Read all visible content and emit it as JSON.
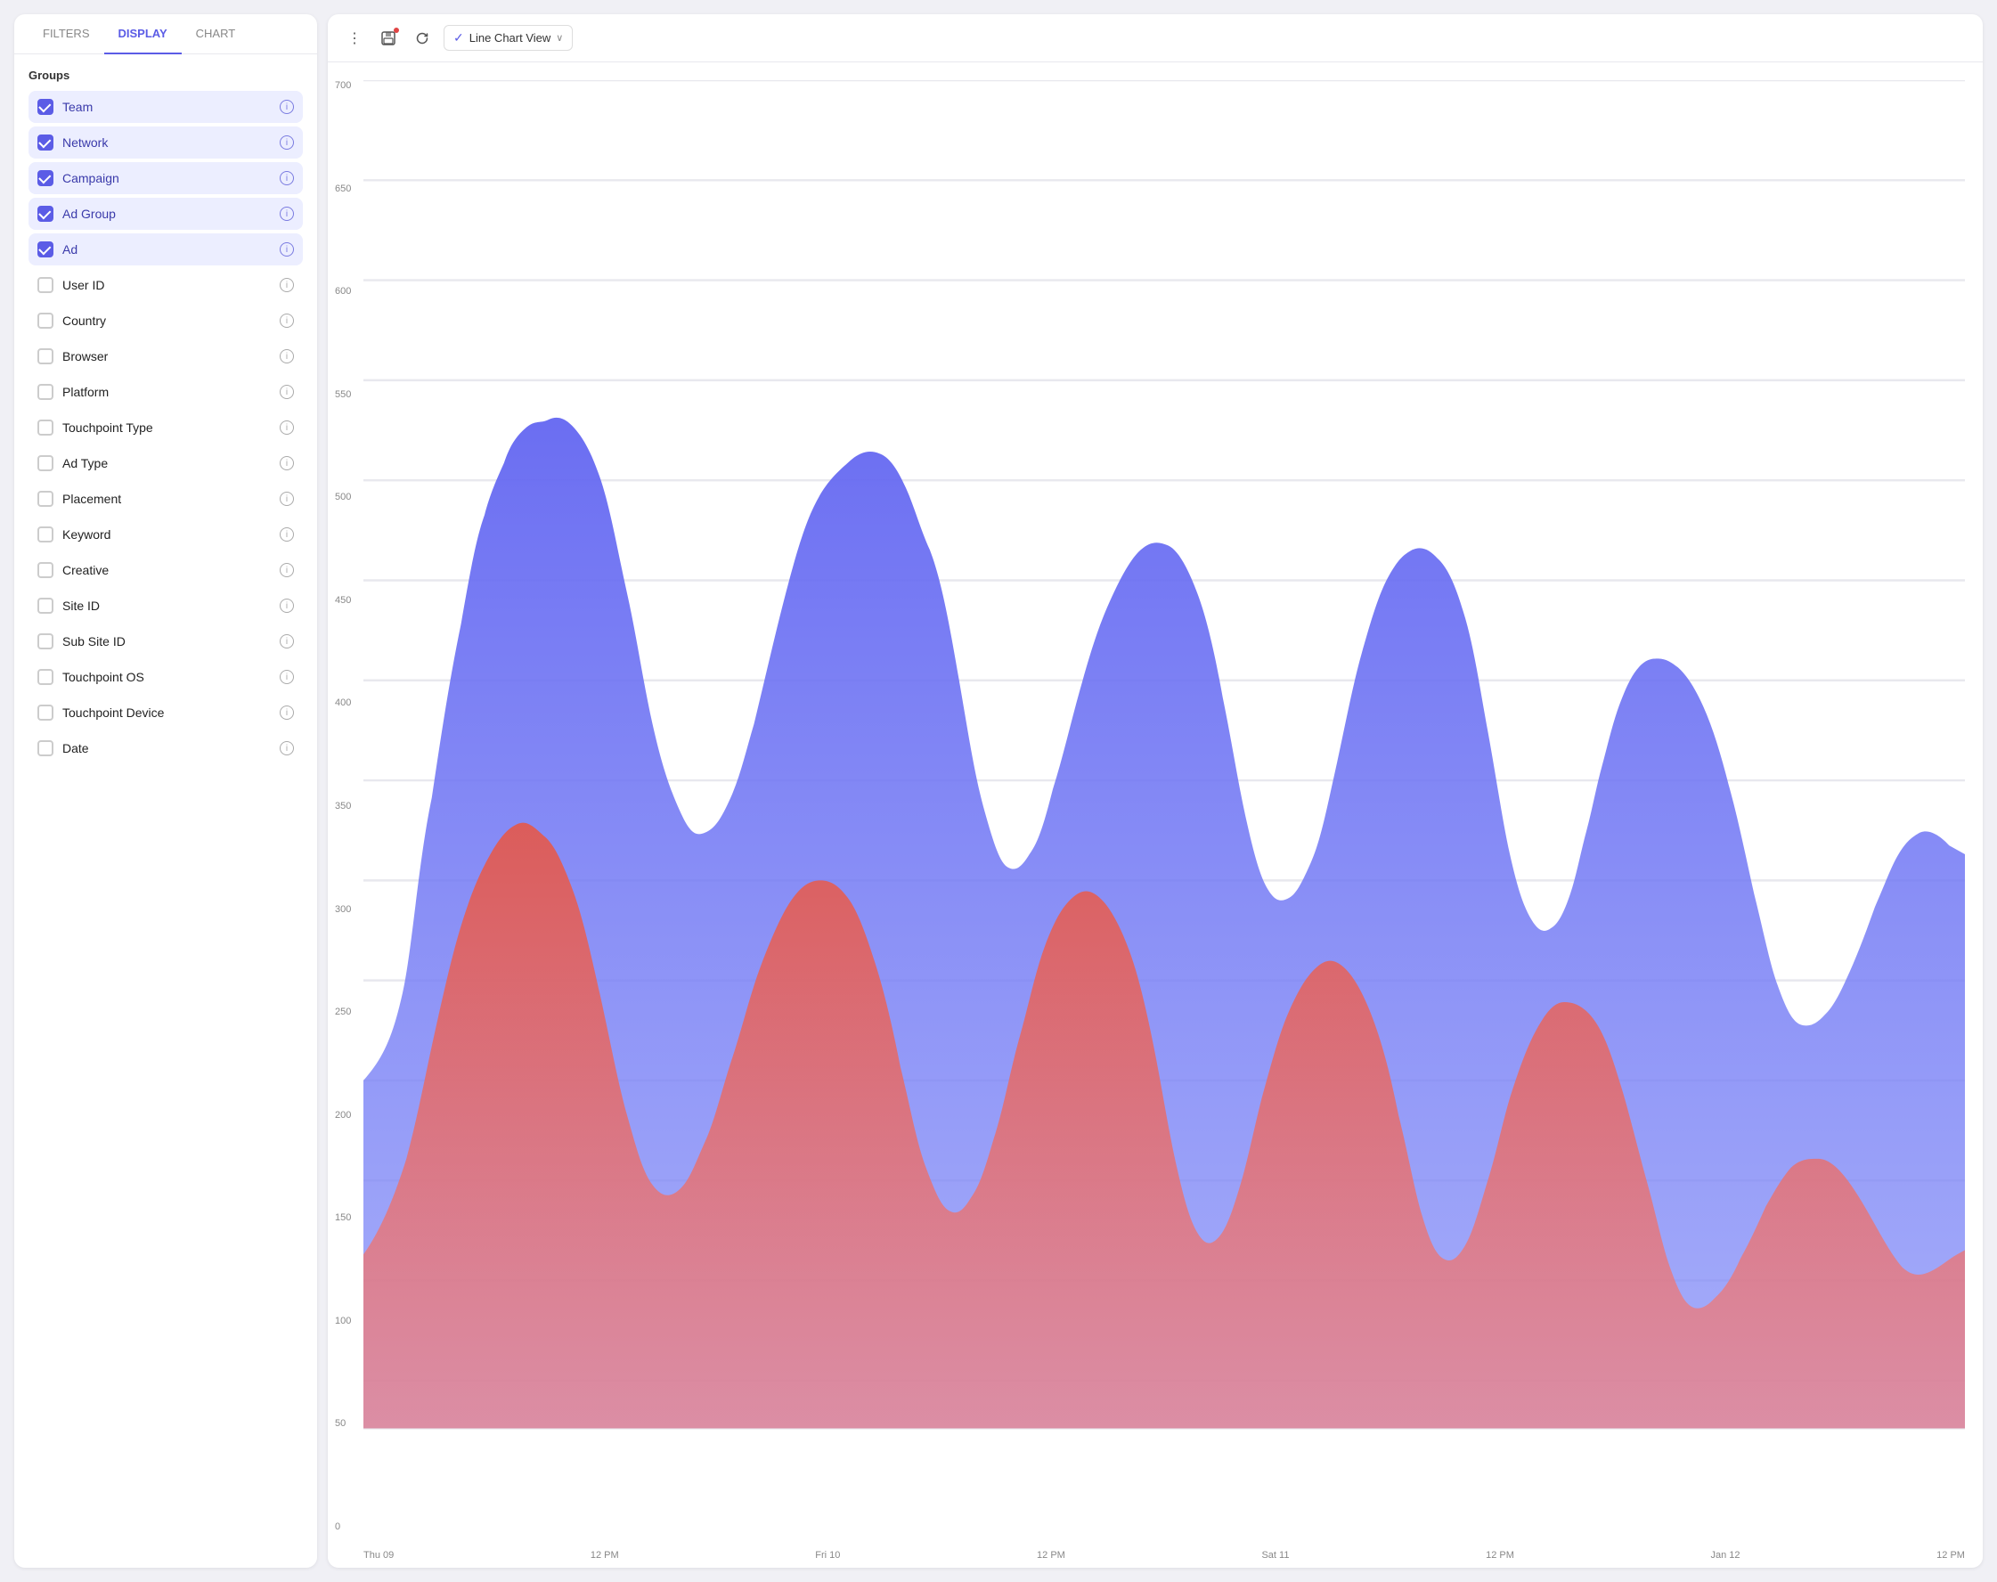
{
  "tabs": [
    {
      "id": "filters",
      "label": "FILTERS",
      "active": false
    },
    {
      "id": "display",
      "label": "DISPLAY",
      "active": true
    },
    {
      "id": "chart",
      "label": "CHART",
      "active": false
    }
  ],
  "groups_label": "Groups",
  "items": [
    {
      "id": "team",
      "label": "Team",
      "checked": true
    },
    {
      "id": "network",
      "label": "Network",
      "checked": true
    },
    {
      "id": "campaign",
      "label": "Campaign",
      "checked": true
    },
    {
      "id": "ad-group",
      "label": "Ad Group",
      "checked": true
    },
    {
      "id": "ad",
      "label": "Ad",
      "checked": true
    },
    {
      "id": "user-id",
      "label": "User ID",
      "checked": false
    },
    {
      "id": "country",
      "label": "Country",
      "checked": false
    },
    {
      "id": "browser",
      "label": "Browser",
      "checked": false
    },
    {
      "id": "platform",
      "label": "Platform",
      "checked": false
    },
    {
      "id": "touchpoint-type",
      "label": "Touchpoint Type",
      "checked": false
    },
    {
      "id": "ad-type",
      "label": "Ad Type",
      "checked": false
    },
    {
      "id": "placement",
      "label": "Placement",
      "checked": false
    },
    {
      "id": "keyword",
      "label": "Keyword",
      "checked": false
    },
    {
      "id": "creative",
      "label": "Creative",
      "checked": false
    },
    {
      "id": "site-id",
      "label": "Site ID",
      "checked": false
    },
    {
      "id": "sub-site-id",
      "label": "Sub Site ID",
      "checked": false
    },
    {
      "id": "touchpoint-os",
      "label": "Touchpoint OS",
      "checked": false
    },
    {
      "id": "touchpoint-device",
      "label": "Touchpoint Device",
      "checked": false
    },
    {
      "id": "date",
      "label": "Date",
      "checked": false
    }
  ],
  "toolbar": {
    "more_icon": "⋮",
    "save_icon": "💾",
    "refresh_icon": "↻",
    "chart_view_label": "Line Chart View",
    "checkmark": "✓",
    "chevron": "∨"
  },
  "chart": {
    "y_labels": [
      "700",
      "650",
      "600",
      "550",
      "500",
      "450",
      "400",
      "350",
      "300",
      "250",
      "200",
      "150",
      "100",
      "50",
      "0"
    ],
    "x_labels": [
      "Thu 09",
      "12 PM",
      "Fri 10",
      "12 PM",
      "Sat 11",
      "12 PM",
      "Jan 12",
      "12 PM"
    ]
  }
}
